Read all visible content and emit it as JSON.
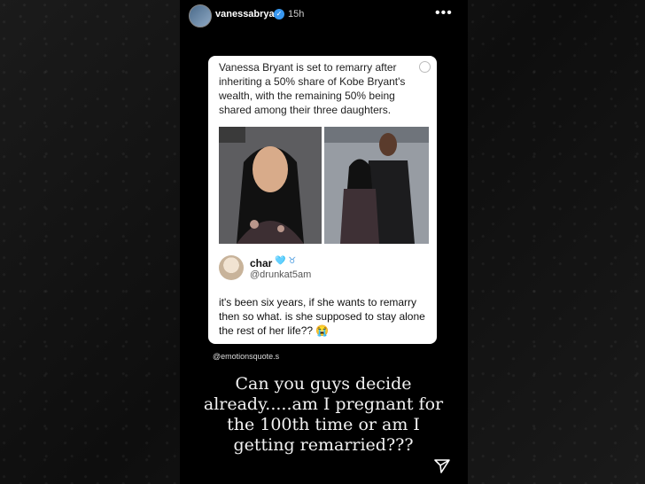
{
  "story": {
    "username": "vanessabryant",
    "time": "15h",
    "more_icon": "•••"
  },
  "post": {
    "text": "Vanessa Bryant is set to remarry after inheriting a 50% share of Kobe Bryant's wealth, with the remaining 50% being shared among their three daughters.",
    "tweet": {
      "name": "char",
      "emoji": "🩵 ♉︎",
      "handle": "@drunkat5am",
      "body": "it's been six years, if she wants to remarry then so what. is she supposed to stay alone the rest of her life?? 😭"
    }
  },
  "credit": "@emotionsquote.s",
  "caption": "Can you guys decide already.....am I pregnant for the 100th time or am I getting remarried???",
  "colors": {
    "story_bg": "#000000",
    "card_bg": "#ffffff",
    "verified": "#3897f0"
  }
}
